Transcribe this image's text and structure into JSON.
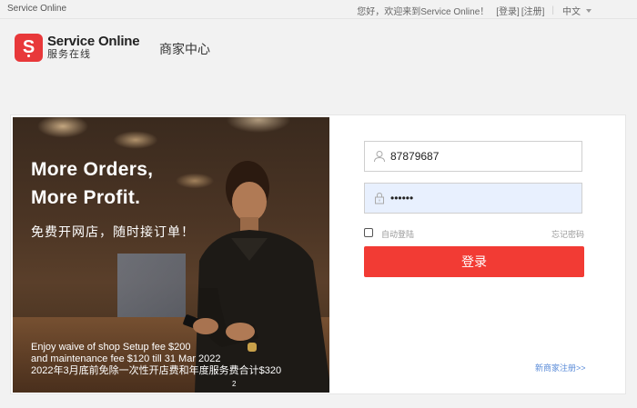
{
  "topbar": {
    "site_name": "Service Online",
    "welcome": "您好，欢迎来到Service Online！",
    "login_link": "[登录]",
    "register_link": "[注册]",
    "separator": "|",
    "language": "中文"
  },
  "header": {
    "logo_letter": "S",
    "brand_en": "Service Online",
    "brand_zh": "服务在线",
    "center_title": "商家中心"
  },
  "banner": {
    "headline_1": "More Orders,",
    "headline_2": "More Profit.",
    "subtitle": "免费开网店，随时接订单！",
    "promo_1": "Enjoy waive of shop Setup fee $200",
    "promo_2": "and maintenance fee $120 till 31 Mar 2022",
    "promo_3": "2022年3月底前免除一次性开店费和年度服务费合计$320",
    "pager": "2"
  },
  "form": {
    "username_value": "87879687",
    "password_value": "••••••",
    "auto_login_label": "自动登陆",
    "forgot_label": "忘记密码",
    "login_button": "登录",
    "register_link": "新商家注册>>"
  },
  "colors": {
    "brand_red": "#e8383a",
    "button_red": "#f23b34",
    "link_blue": "#5a8bd8",
    "password_bg": "#e8f0fe"
  },
  "icons": [
    "user-icon",
    "lock-icon",
    "chevron-down-icon"
  ]
}
